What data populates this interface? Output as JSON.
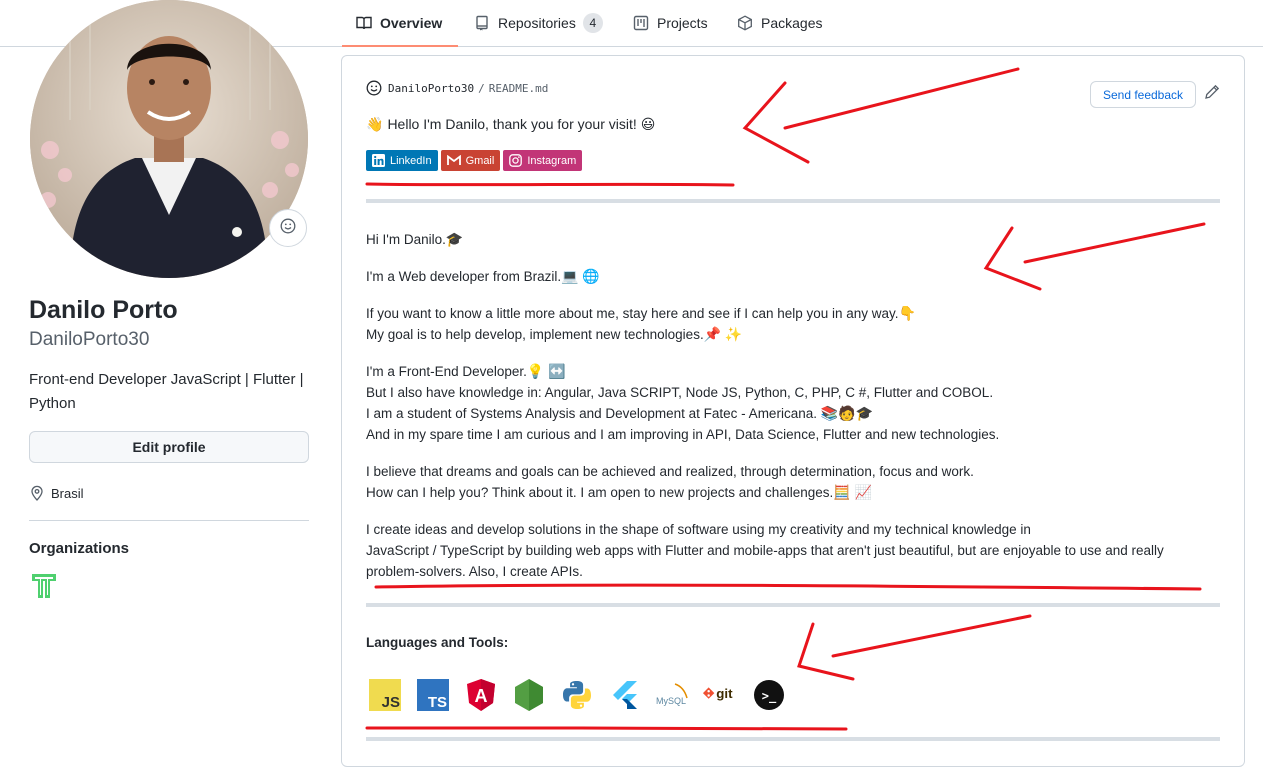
{
  "nav": {
    "tabs": [
      {
        "label": "Overview",
        "icon": "book-icon",
        "active": true
      },
      {
        "label": "Repositories",
        "icon": "repo-icon",
        "count": "4"
      },
      {
        "label": "Projects",
        "icon": "project-icon"
      },
      {
        "label": "Packages",
        "icon": "package-icon"
      }
    ]
  },
  "profile": {
    "name": "Danilo Porto",
    "login": "DaniloPorto30",
    "bio": "Front-end Developer JavaScript | Flutter | Python",
    "edit_label": "Edit profile",
    "location": "Brasil",
    "organizations_heading": "Organizations"
  },
  "readme": {
    "user": "DaniloPorto30",
    "file": "README.md",
    "feedback_label": "Send feedback",
    "hello": "Hello I'm Danilo, thank you for your visit!",
    "badges": [
      {
        "label": "LinkedIn",
        "color": "#0077b5"
      },
      {
        "label": "Gmail",
        "color": "#d14836"
      },
      {
        "label": "Instagram",
        "color": "#e4405f"
      }
    ],
    "paragraphs": [
      [
        "Hi I'm Danilo."
      ],
      [
        "I'm a Web developer from Brazil."
      ],
      [
        "If you want to know a little more about me, stay here and see if I can help you in any way.",
        "My goal is to help develop, implement new technologies."
      ],
      [
        "I'm a Front-End Developer.",
        "But I also have knowledge in: Angular, Java SCRIPT, Node JS, Python, C, PHP, C #, Flutter and COBOL.",
        "I am a student of Systems Analysis and Development at Fatec - Americana.",
        "And in my spare time I am curious and I am improving in API, Data Science, Flutter and new technologies."
      ],
      [
        "I believe that dreams and goals can be achieved and realized, through determination, focus and work.",
        "How can I help you? Think about it. I am open to new projects and challenges."
      ],
      [
        "I create ideas and develop solutions in the shape of software using my creativity and my technical knowledge in",
        "JavaScript / TypeScript by building web apps with Flutter and mobile-apps that aren't just beautiful, but are enjoyable to use and really",
        "problem-solvers. Also, I create APIs."
      ]
    ],
    "tools_heading": "Languages and Tools:",
    "tools": [
      {
        "label": "JS",
        "icon": "javascript-icon"
      },
      {
        "label": "TS",
        "icon": "typescript-icon"
      },
      {
        "label": "A",
        "icon": "angular-icon"
      },
      {
        "label": "",
        "icon": "nodejs-icon"
      },
      {
        "label": "",
        "icon": "python-icon"
      },
      {
        "label": "",
        "icon": "flutter-icon"
      },
      {
        "label": "MySQL",
        "icon": "mysql-icon"
      },
      {
        "label": "git",
        "icon": "git-icon"
      },
      {
        "label": ">_",
        "icon": "terminal-icon"
      }
    ]
  },
  "colors": {
    "accent_underline": "#fd8c73",
    "link": "#0969da",
    "annotation_red": "#e8141c"
  }
}
